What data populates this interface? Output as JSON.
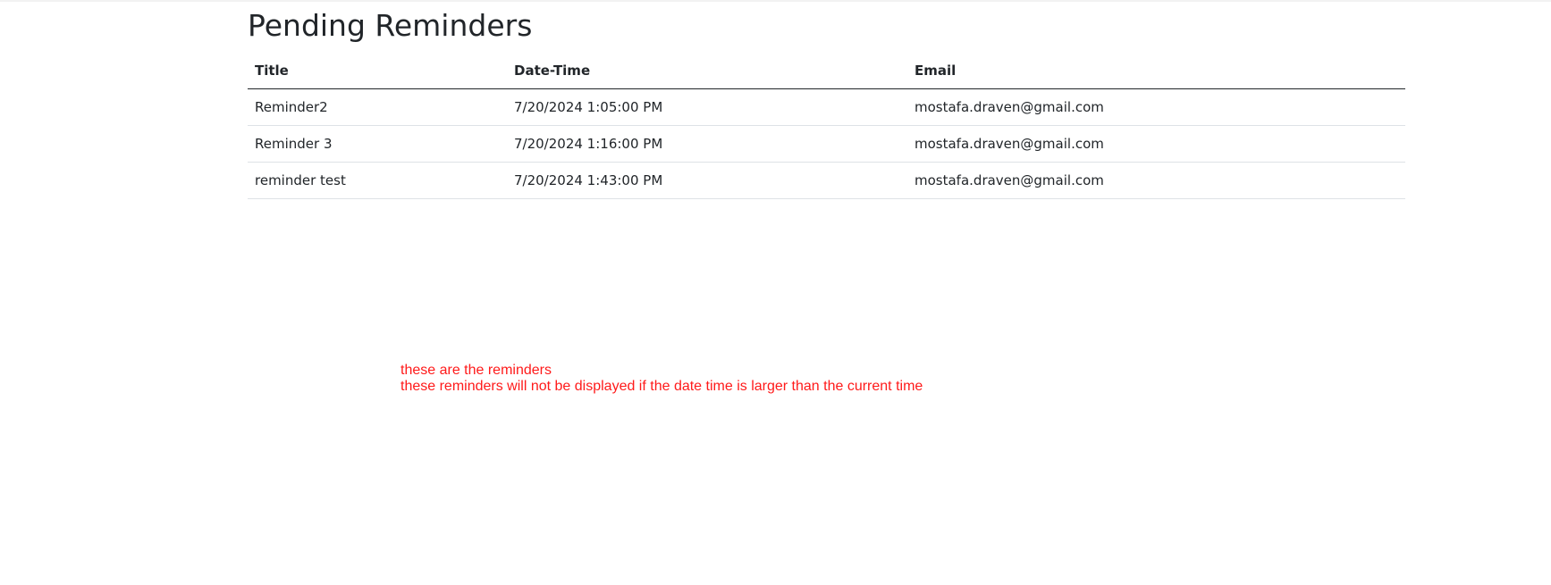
{
  "page": {
    "title": "Pending Reminders"
  },
  "table": {
    "headers": [
      "Title",
      "Date-Time",
      "Email"
    ],
    "rows": [
      {
        "title": "Reminder2",
        "datetime": "7/20/2024 1:05:00 PM",
        "email": "mostafa.draven@gmail.com"
      },
      {
        "title": "Reminder 3",
        "datetime": "7/20/2024 1:16:00 PM",
        "email": "mostafa.draven@gmail.com"
      },
      {
        "title": "reminder test",
        "datetime": "7/20/2024 1:43:00 PM",
        "email": "mostafa.draven@gmail.com"
      }
    ]
  },
  "annotation": {
    "line1": "these are the reminders",
    "line2": "these reminders will not be displayed if the date time is larger than the current time",
    "color": "#ff1a1a"
  }
}
